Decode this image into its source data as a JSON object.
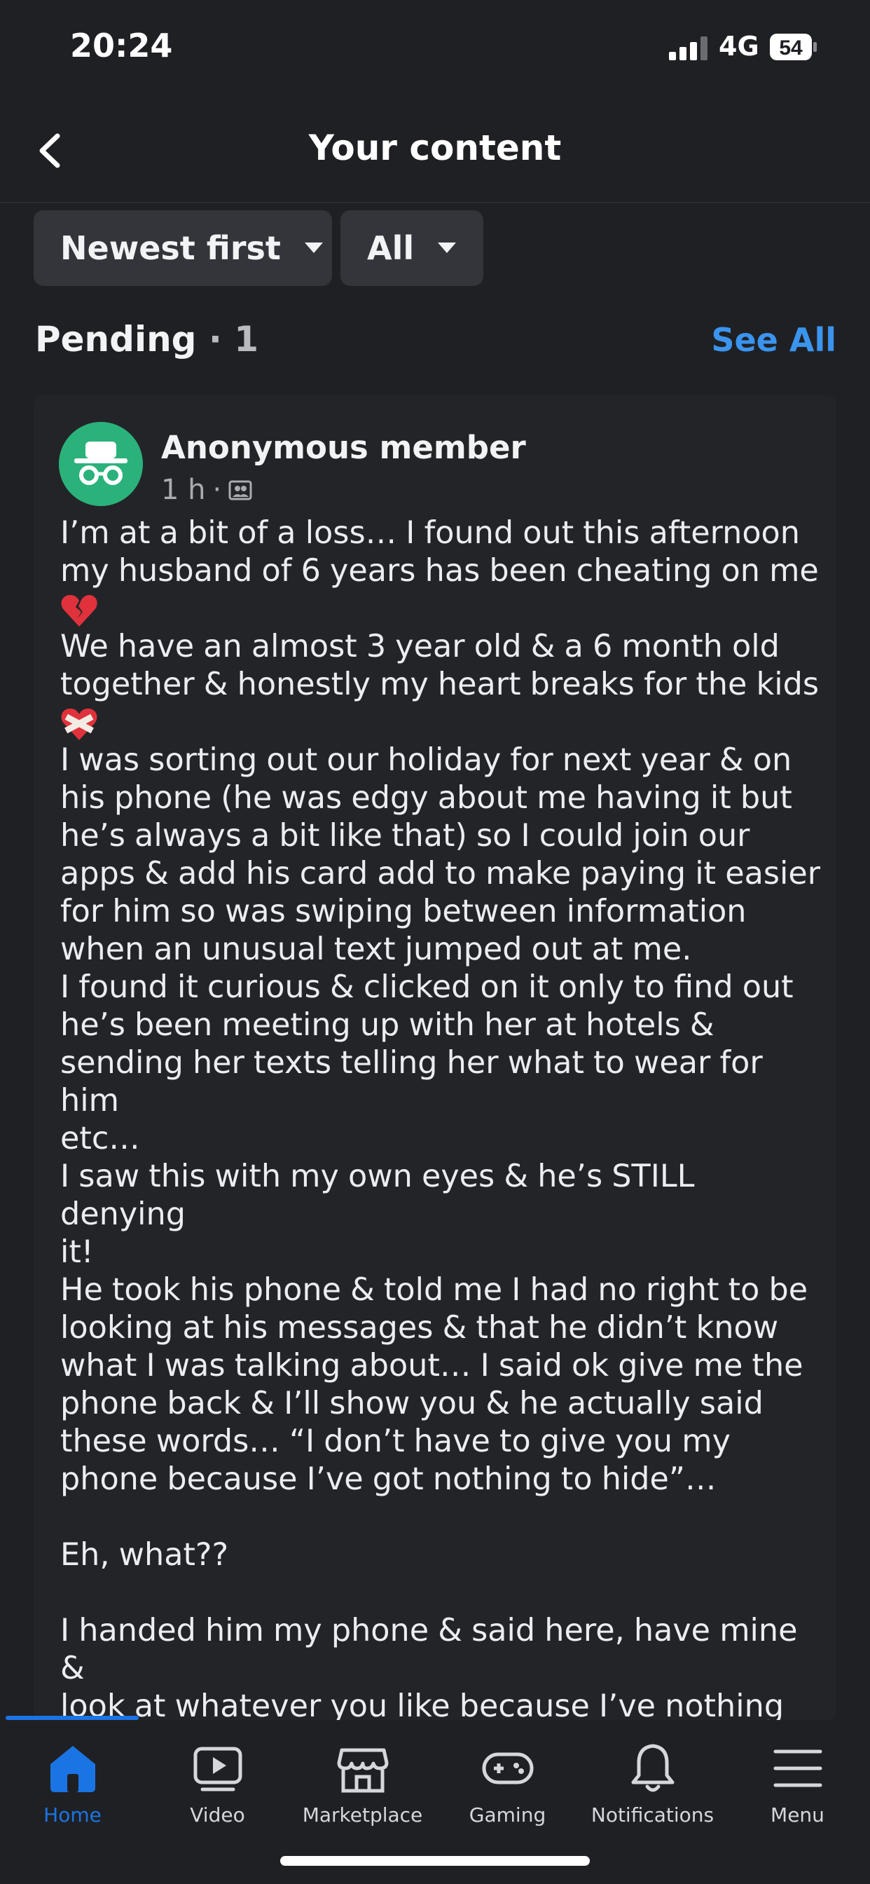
{
  "status_bar": {
    "time": "20:24",
    "network": "4G",
    "battery": "54"
  },
  "header": {
    "title": "Your content",
    "back_icon": "chevron-left-icon"
  },
  "filters": [
    {
      "label": "Newest first",
      "icon": "caret-down-icon"
    },
    {
      "label": "All",
      "icon": "caret-down-icon"
    }
  ],
  "pending": {
    "label": "Pending",
    "count_text": " · 1",
    "see_all": "See All"
  },
  "post": {
    "author": "Anonymous member",
    "time": "1 h",
    "audience_icon": "group-members-icon",
    "avatar_icon": "anonymous-incognito-icon",
    "line1": "I’m at a bit of a loss… I found out this afternoon\nmy husband of 6 years has been cheating on me\n",
    "line2": "\nWe have an almost 3 year old & a 6 month old\ntogether & honestly my heart breaks for the kids\n",
    "line3": "\nI was sorting out our holiday for next year & on\nhis phone (he was edgy about me having it but\nhe’s always a bit like that) so I could join our\napps & add his card add to make paying it easier\nfor him so was swiping between information\nwhen an unusual text jumped out at me.\nI found it curious & clicked on it only to find out\nhe’s been meeting up with her at hotels &\nsending her texts telling her what to wear for him\netc…\nI saw this with my own eyes & he’s STILL denying\nit!\nHe took his phone & told me I had no right to be\nlooking at his messages & that he didn’t know\nwhat I was talking about… I said ok give me the\nphone back & I’ll show you & he actually said\nthese words… “I don’t have to give you my\nphone because I’ve got nothing to hide”…\n\nEh, what??\n\nI handed him my phone & said here, have mine &\nlook at whatever you like because I’ve nothing to\nhide… That’s how that’s supposed to go!\nHe messed with his phone stalling for about 10\nminutes & said ok fine have it then & low &",
    "emoji1": "broken-heart-emoji",
    "emoji2": "mending-heart-emoji"
  },
  "tabbar": [
    {
      "label": "Home",
      "icon": "home-icon",
      "active": true
    },
    {
      "label": "Video",
      "icon": "video-icon"
    },
    {
      "label": "Marketplace",
      "icon": "marketplace-icon"
    },
    {
      "label": "Gaming",
      "icon": "gaming-icon"
    },
    {
      "label": "Notifications",
      "icon": "bell-icon"
    },
    {
      "label": "Menu",
      "icon": "menu-icon"
    }
  ],
  "colors": {
    "accent": "#1b74e4",
    "link": "#3b94ee",
    "avatar": "#2bb27b",
    "background": "#1f2024"
  }
}
